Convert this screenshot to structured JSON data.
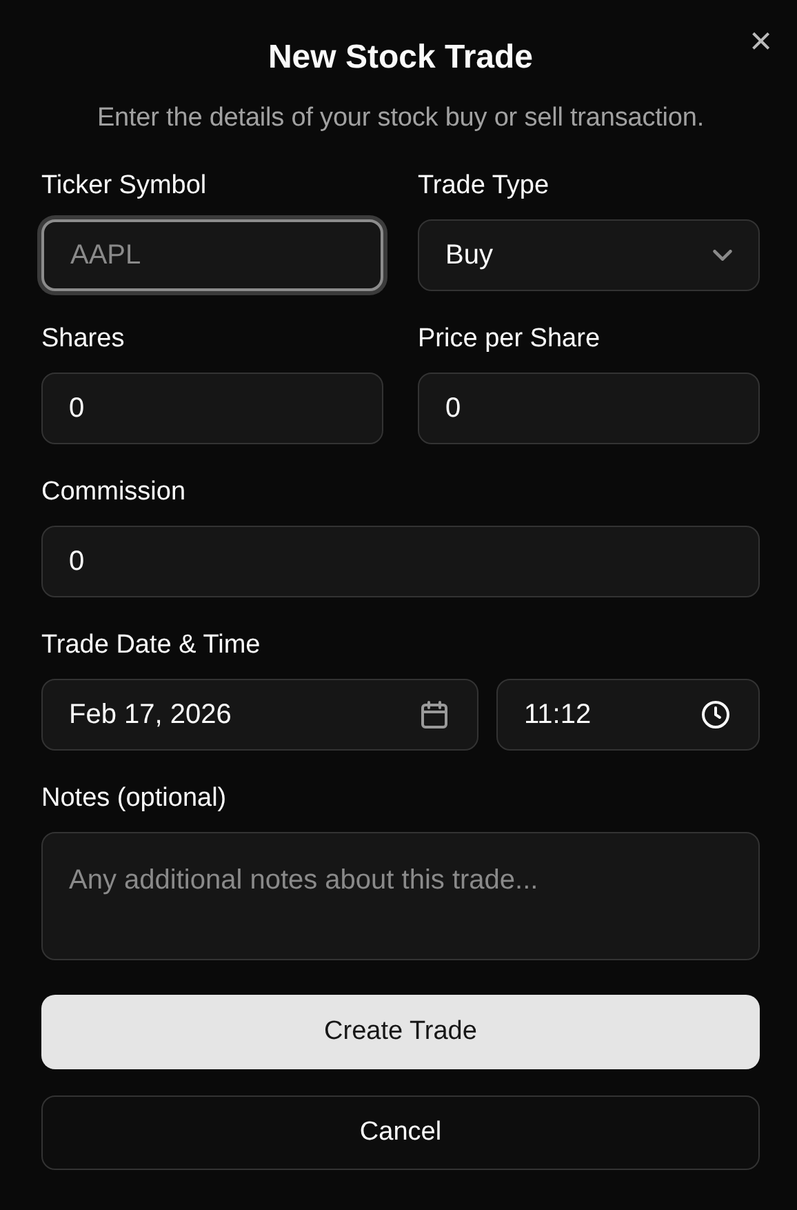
{
  "dialog": {
    "title": "New Stock Trade",
    "description": "Enter the details of your stock buy or sell transaction.",
    "close": "×"
  },
  "rows": [
    {
      "cells": [
        {
          "label": "Ticker Symbol",
          "control": {
            "kind": "text",
            "placeholder": "AAPL",
            "focused": true
          }
        },
        {
          "label": "Trade Type",
          "control": {
            "kind": "select",
            "value": "Buy",
            "focused": false
          }
        }
      ]
    },
    {
      "cells": [
        {
          "label": "Shares",
          "control": {
            "kind": "text",
            "value": "0",
            "focused": false
          }
        },
        {
          "label": "Price per Share",
          "control": {
            "kind": "text",
            "value": "0",
            "focused": false
          }
        }
      ]
    },
    {
      "cells": [
        {
          "label": "Commission",
          "control": {
            "kind": "text",
            "value": "0",
            "focused": false
          }
        }
      ]
    },
    {
      "label": "Trade Date & Time",
      "controls": [
        {
          "kind": "date",
          "value": "Feb 17, 2026",
          "focused": false
        },
        {
          "kind": "time",
          "value": "11:12",
          "focused": false
        }
      ]
    },
    {
      "cells": [
        {
          "label": "Notes (optional)",
          "control": {
            "kind": "textarea",
            "placeholder": "Any additional notes about this trade...",
            "focused": false
          }
        }
      ]
    }
  ],
  "buttons": [
    {
      "label": "Create Trade",
      "kind": "primary"
    },
    {
      "label": "Cancel",
      "kind": "secondary"
    }
  ]
}
